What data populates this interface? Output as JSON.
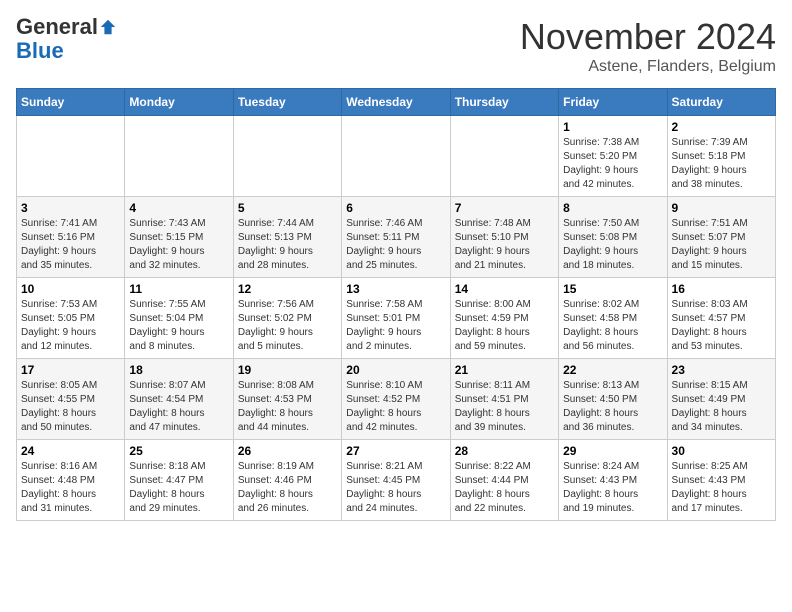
{
  "header": {
    "logo_general": "General",
    "logo_blue": "Blue",
    "month_title": "November 2024",
    "location": "Astene, Flanders, Belgium"
  },
  "weekdays": [
    "Sunday",
    "Monday",
    "Tuesday",
    "Wednesday",
    "Thursday",
    "Friday",
    "Saturday"
  ],
  "weeks": [
    [
      {
        "day": "",
        "info": ""
      },
      {
        "day": "",
        "info": ""
      },
      {
        "day": "",
        "info": ""
      },
      {
        "day": "",
        "info": ""
      },
      {
        "day": "",
        "info": ""
      },
      {
        "day": "1",
        "info": "Sunrise: 7:38 AM\nSunset: 5:20 PM\nDaylight: 9 hours\nand 42 minutes."
      },
      {
        "day": "2",
        "info": "Sunrise: 7:39 AM\nSunset: 5:18 PM\nDaylight: 9 hours\nand 38 minutes."
      }
    ],
    [
      {
        "day": "3",
        "info": "Sunrise: 7:41 AM\nSunset: 5:16 PM\nDaylight: 9 hours\nand 35 minutes."
      },
      {
        "day": "4",
        "info": "Sunrise: 7:43 AM\nSunset: 5:15 PM\nDaylight: 9 hours\nand 32 minutes."
      },
      {
        "day": "5",
        "info": "Sunrise: 7:44 AM\nSunset: 5:13 PM\nDaylight: 9 hours\nand 28 minutes."
      },
      {
        "day": "6",
        "info": "Sunrise: 7:46 AM\nSunset: 5:11 PM\nDaylight: 9 hours\nand 25 minutes."
      },
      {
        "day": "7",
        "info": "Sunrise: 7:48 AM\nSunset: 5:10 PM\nDaylight: 9 hours\nand 21 minutes."
      },
      {
        "day": "8",
        "info": "Sunrise: 7:50 AM\nSunset: 5:08 PM\nDaylight: 9 hours\nand 18 minutes."
      },
      {
        "day": "9",
        "info": "Sunrise: 7:51 AM\nSunset: 5:07 PM\nDaylight: 9 hours\nand 15 minutes."
      }
    ],
    [
      {
        "day": "10",
        "info": "Sunrise: 7:53 AM\nSunset: 5:05 PM\nDaylight: 9 hours\nand 12 minutes."
      },
      {
        "day": "11",
        "info": "Sunrise: 7:55 AM\nSunset: 5:04 PM\nDaylight: 9 hours\nand 8 minutes."
      },
      {
        "day": "12",
        "info": "Sunrise: 7:56 AM\nSunset: 5:02 PM\nDaylight: 9 hours\nand 5 minutes."
      },
      {
        "day": "13",
        "info": "Sunrise: 7:58 AM\nSunset: 5:01 PM\nDaylight: 9 hours\nand 2 minutes."
      },
      {
        "day": "14",
        "info": "Sunrise: 8:00 AM\nSunset: 4:59 PM\nDaylight: 8 hours\nand 59 minutes."
      },
      {
        "day": "15",
        "info": "Sunrise: 8:02 AM\nSunset: 4:58 PM\nDaylight: 8 hours\nand 56 minutes."
      },
      {
        "day": "16",
        "info": "Sunrise: 8:03 AM\nSunset: 4:57 PM\nDaylight: 8 hours\nand 53 minutes."
      }
    ],
    [
      {
        "day": "17",
        "info": "Sunrise: 8:05 AM\nSunset: 4:55 PM\nDaylight: 8 hours\nand 50 minutes."
      },
      {
        "day": "18",
        "info": "Sunrise: 8:07 AM\nSunset: 4:54 PM\nDaylight: 8 hours\nand 47 minutes."
      },
      {
        "day": "19",
        "info": "Sunrise: 8:08 AM\nSunset: 4:53 PM\nDaylight: 8 hours\nand 44 minutes."
      },
      {
        "day": "20",
        "info": "Sunrise: 8:10 AM\nSunset: 4:52 PM\nDaylight: 8 hours\nand 42 minutes."
      },
      {
        "day": "21",
        "info": "Sunrise: 8:11 AM\nSunset: 4:51 PM\nDaylight: 8 hours\nand 39 minutes."
      },
      {
        "day": "22",
        "info": "Sunrise: 8:13 AM\nSunset: 4:50 PM\nDaylight: 8 hours\nand 36 minutes."
      },
      {
        "day": "23",
        "info": "Sunrise: 8:15 AM\nSunset: 4:49 PM\nDaylight: 8 hours\nand 34 minutes."
      }
    ],
    [
      {
        "day": "24",
        "info": "Sunrise: 8:16 AM\nSunset: 4:48 PM\nDaylight: 8 hours\nand 31 minutes."
      },
      {
        "day": "25",
        "info": "Sunrise: 8:18 AM\nSunset: 4:47 PM\nDaylight: 8 hours\nand 29 minutes."
      },
      {
        "day": "26",
        "info": "Sunrise: 8:19 AM\nSunset: 4:46 PM\nDaylight: 8 hours\nand 26 minutes."
      },
      {
        "day": "27",
        "info": "Sunrise: 8:21 AM\nSunset: 4:45 PM\nDaylight: 8 hours\nand 24 minutes."
      },
      {
        "day": "28",
        "info": "Sunrise: 8:22 AM\nSunset: 4:44 PM\nDaylight: 8 hours\nand 22 minutes."
      },
      {
        "day": "29",
        "info": "Sunrise: 8:24 AM\nSunset: 4:43 PM\nDaylight: 8 hours\nand 19 minutes."
      },
      {
        "day": "30",
        "info": "Sunrise: 8:25 AM\nSunset: 4:43 PM\nDaylight: 8 hours\nand 17 minutes."
      }
    ]
  ]
}
